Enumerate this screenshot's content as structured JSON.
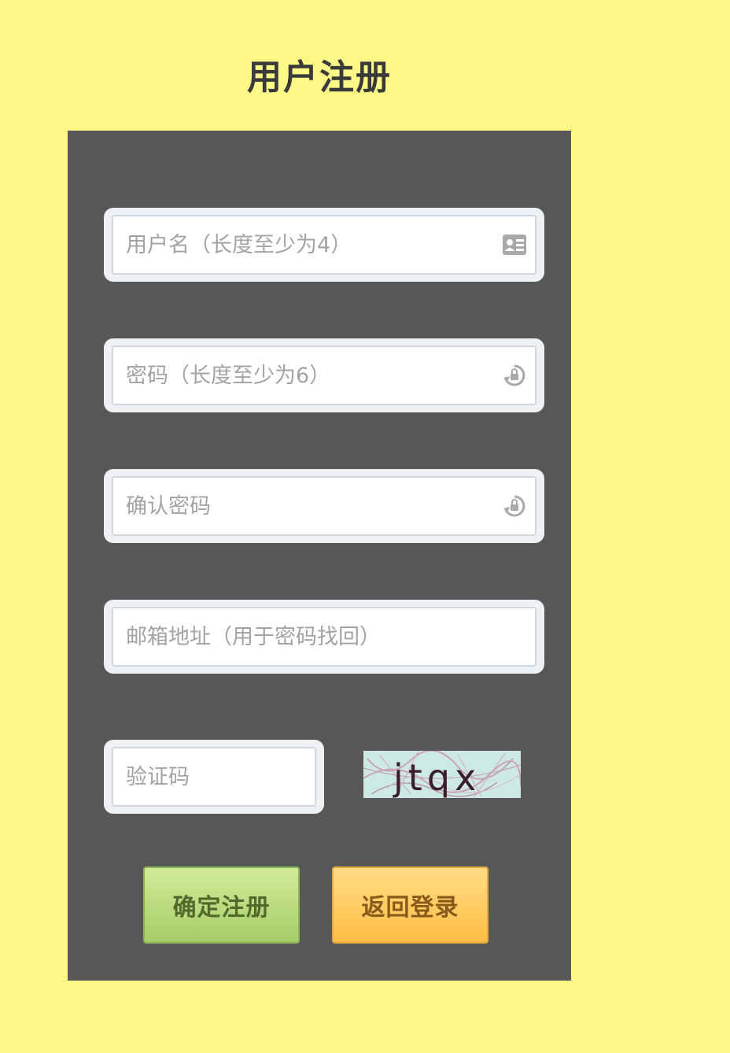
{
  "page": {
    "title": "用户注册"
  },
  "form": {
    "username_placeholder": "用户名（长度至少为4）",
    "password_placeholder": "密码（长度至少为6）",
    "confirm_placeholder": "确认密码",
    "email_placeholder": "邮箱地址（用于密码找回）",
    "captcha_placeholder": "验证码",
    "captcha_text": "jtqx"
  },
  "icons": {
    "username": "id-card-icon",
    "password": "lock-refresh-icon",
    "confirm": "lock-refresh-icon"
  },
  "buttons": {
    "register_label": "确定注册",
    "back_label": "返回登录"
  },
  "colors": {
    "background": "#fffa88",
    "panel": "#575757",
    "register_button": "#b7d97b",
    "back_button": "#ffc95c"
  }
}
